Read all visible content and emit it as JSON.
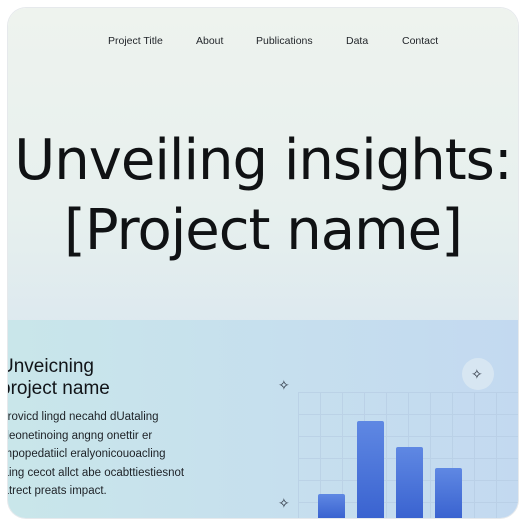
{
  "nav": {
    "items": [
      "Project Title",
      "About",
      "Publications",
      "Data",
      "Contact"
    ]
  },
  "hero": {
    "line1": "Unveiling insights:",
    "line2": "[Project name]"
  },
  "section": {
    "heading_lines": [
      "Unveicning",
      "oroject name"
    ],
    "body_lines": [
      "Provicd lingd necahd dUataling",
      "ideonetinoing angng onettir er",
      "impopedatiicl eralyonicouoacling",
      "laing cecot allct abe ocabttiestiesnot",
      "iatrect preats impact."
    ]
  },
  "chart_data": {
    "type": "bar",
    "categories": [
      "",
      "",
      "",
      ""
    ],
    "values": [
      0.2,
      0.82,
      0.6,
      0.42
    ],
    "title": "",
    "xlabel": "",
    "ylabel": "",
    "ylim": [
      0,
      1
    ],
    "grid": true
  },
  "colors": {
    "bar": "#4a72d8",
    "text": "#101214"
  },
  "icons": [
    "sparkle-icon",
    "sparkle-icon",
    "sparkle-icon"
  ]
}
